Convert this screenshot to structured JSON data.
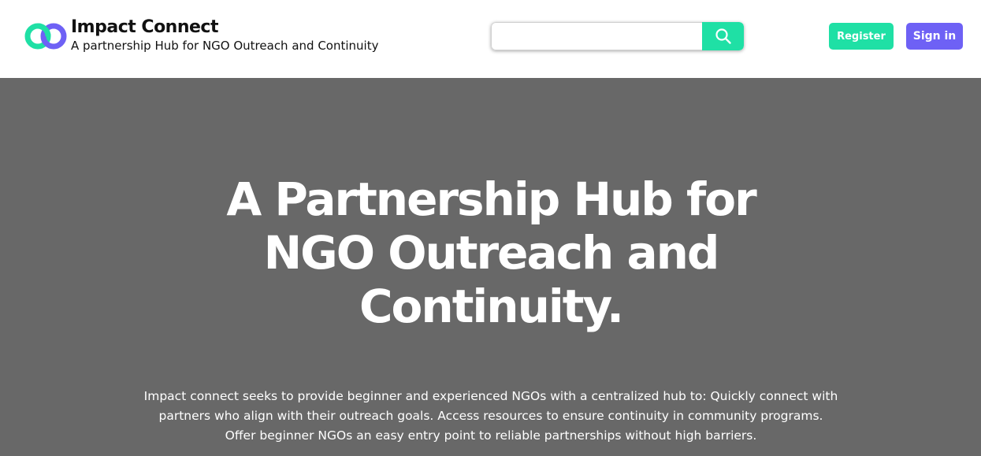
{
  "brand": {
    "title": "Impact Connect",
    "tagline": "A partnership Hub for NGO Outreach and Continuity",
    "logo_icon": "linked-rings-logo",
    "logo_colors": [
      "#1fe0a5",
      "#6e61f5"
    ]
  },
  "search": {
    "placeholder": "",
    "value": "",
    "icon": "search-icon"
  },
  "actions": {
    "register_label": "Register",
    "signin_label": "Sign in"
  },
  "hero": {
    "title": "A Partnership Hub for NGO Outreach and Continuity.",
    "description": "Impact connect seeks to provide beginner and experienced NGOs with a centralized hub to: Quickly connect with partners who align with their outreach goals. Access resources to ensure continuity in community programs. Offer beginner NGOs an easy entry point to reliable partnerships without high barriers."
  },
  "colors": {
    "accent_green": "#1fe0a5",
    "accent_purple": "#6e61f5",
    "hero_background": "#686868"
  }
}
